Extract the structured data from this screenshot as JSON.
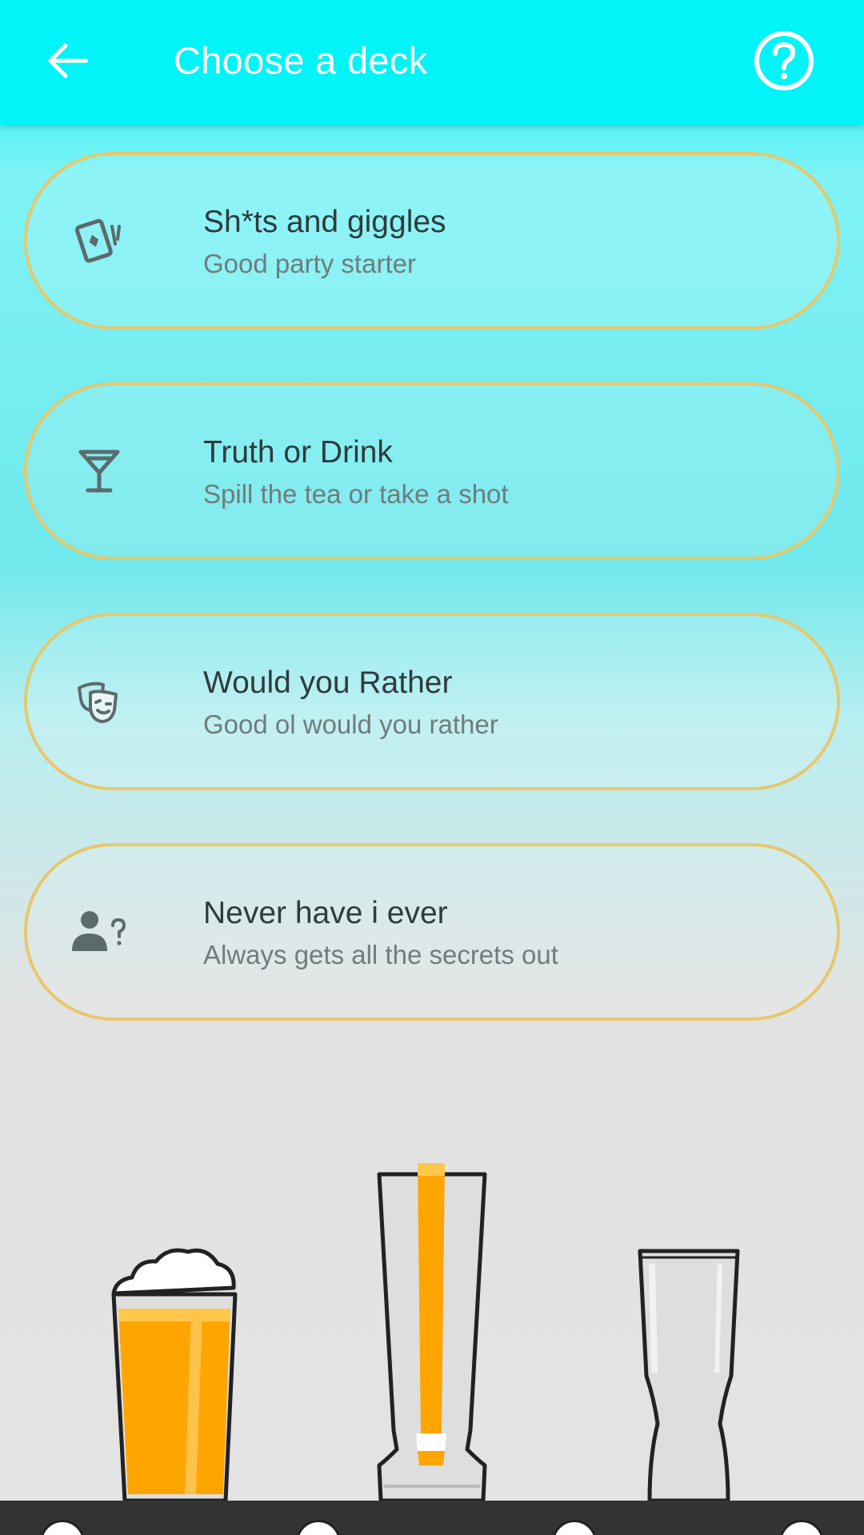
{
  "appbar": {
    "title": "Choose a deck",
    "back_icon": "arrow-left-icon",
    "help_icon": "help-circle-icon"
  },
  "decks": [
    {
      "title": "Sh*ts and giggles",
      "subtitle": "Good party starter",
      "icon": "cards-icon"
    },
    {
      "title": "Truth or Drink",
      "subtitle": "Spill the tea or take a shot",
      "icon": "cocktail-glass-icon"
    },
    {
      "title": "Would you Rather",
      "subtitle": "Good ol would you rather",
      "icon": "theater-masks-icon"
    },
    {
      "title": "Never have i ever",
      "subtitle": "Always gets all the secrets out",
      "icon": "person-question-icon"
    }
  ],
  "colors": {
    "appbar": "#00f4f8",
    "card_border": "#e6c86c",
    "beer": "#ffa500",
    "text_primary": "#2f3b3d",
    "text_secondary": "#6f7c7e",
    "icon": "#5d6a6c"
  }
}
